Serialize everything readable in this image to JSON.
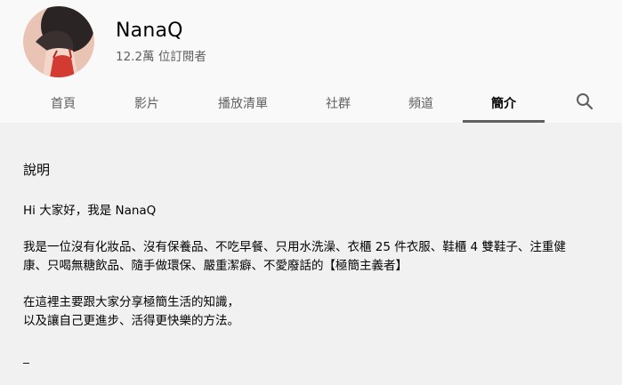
{
  "channel": {
    "name": "NanaQ",
    "subscribers": "12.2萬 位訂閱者"
  },
  "tabs": [
    {
      "label": "首頁",
      "active": false
    },
    {
      "label": "影片",
      "active": false
    },
    {
      "label": "播放清單",
      "active": false
    },
    {
      "label": "社群",
      "active": false
    },
    {
      "label": "頻道",
      "active": false
    },
    {
      "label": "簡介",
      "active": true
    }
  ],
  "search_icon": "search-icon",
  "about": {
    "heading": "說明",
    "paragraphs": [
      "Hi 大家好，我是 NanaQ",
      "我是一位沒有化妝品、沒有保養品、不吃早餐、只用水洗澡、衣櫃 25 件衣服、鞋櫃 4 雙鞋子、注重健\n康、只喝無糖飲品、隨手做環保、嚴重潔癖、不愛廢話的【極簡主義者】",
      "在這裡主要跟大家分享極簡生活的知識，\n以及讓自己更進步、活得更快樂的方法。",
      "_"
    ]
  },
  "colors": {
    "header_bg": "#f9f9f9",
    "page_bg": "#f1f1f1",
    "active_underline": "#606060",
    "secondary_text": "#606060"
  }
}
